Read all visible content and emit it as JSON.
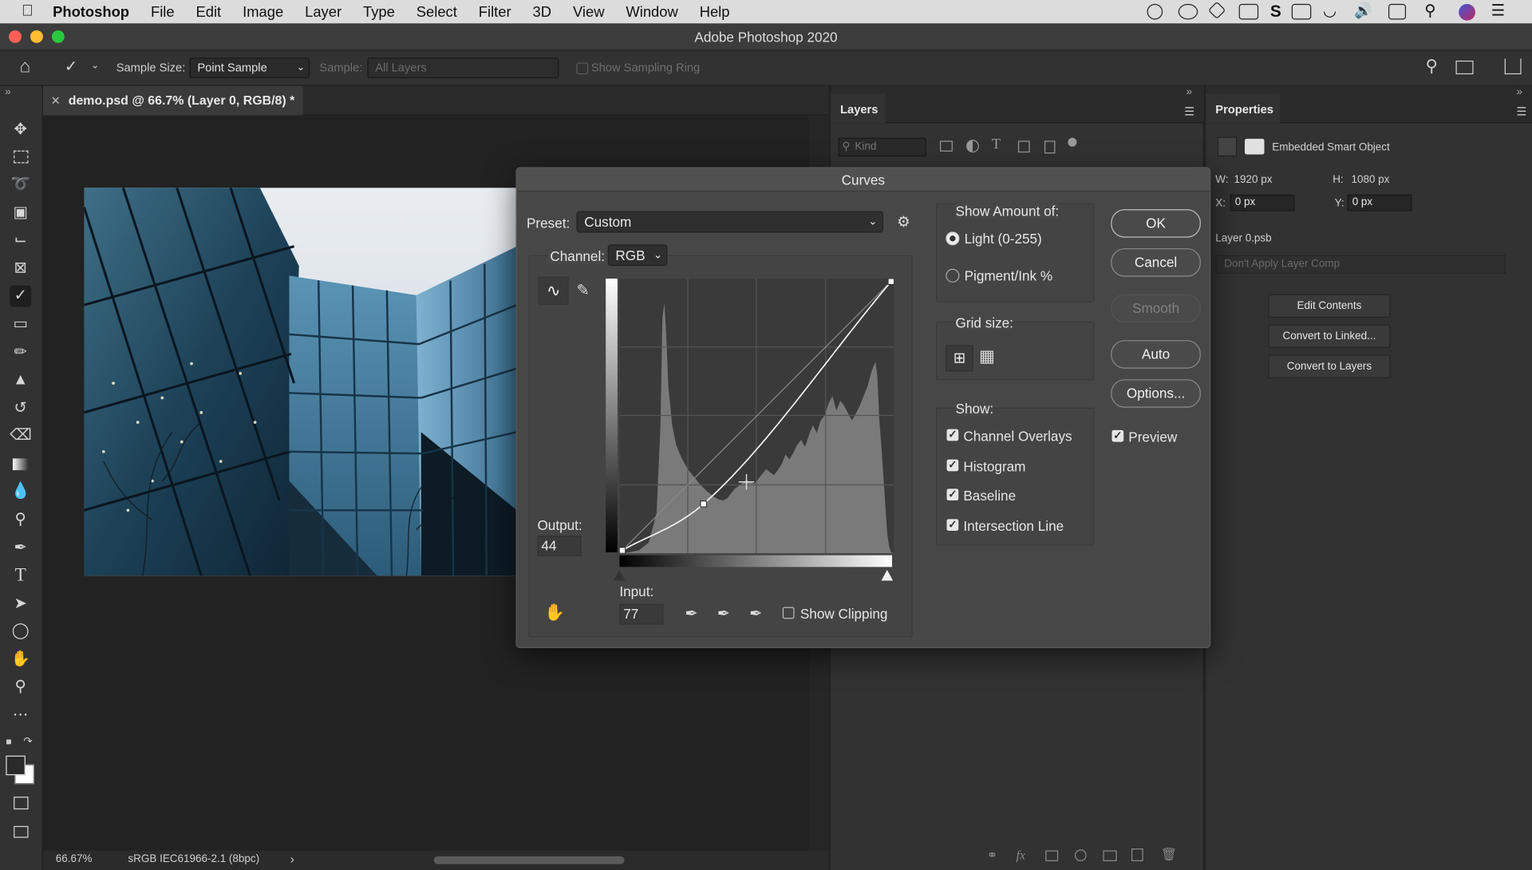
{
  "menubar": {
    "app_name": "Photoshop",
    "items": [
      "File",
      "Edit",
      "Image",
      "Layer",
      "Type",
      "Select",
      "Filter",
      "3D",
      "View",
      "Window",
      "Help"
    ]
  },
  "window": {
    "title": "Adobe Photoshop 2020"
  },
  "options_bar": {
    "sample_size_label": "Sample Size:",
    "sample_size_value": "Point Sample",
    "sample_label": "Sample:",
    "sample_value": "All Layers",
    "show_sampling_ring_label": "Show Sampling Ring"
  },
  "document": {
    "tab_title": "demo.psd @ 66.7% (Layer 0, RGB/8) *",
    "zoom": "66.67%",
    "color_profile": "sRGB IEC61966-2.1 (8bpc)"
  },
  "layers_panel": {
    "title": "Layers",
    "filter_placeholder": "Kind"
  },
  "properties_panel": {
    "title": "Properties",
    "object_type": "Embedded Smart Object",
    "w_label": "W:",
    "w_value": "1920 px",
    "h_label": "H:",
    "h_value": "1080 px",
    "x_label": "X:",
    "x_value": "0 px",
    "y_label": "Y:",
    "y_value": "0 px",
    "source_file": "Layer 0.psb",
    "layer_comp": "Don't Apply Layer Comp",
    "buttons": [
      "Edit Contents",
      "Convert to Linked...",
      "Convert to Layers"
    ]
  },
  "curves_dialog": {
    "title": "Curves",
    "preset_label": "Preset:",
    "preset_value": "Custom",
    "channel_label": "Channel:",
    "channel_value": "RGB",
    "output_label": "Output:",
    "output_value": "44",
    "input_label": "Input:",
    "input_value": "77",
    "show_clipping_label": "Show Clipping",
    "show_clipping_checked": false,
    "show_amount_label": "Show Amount of:",
    "light_label": "Light  (0-255)",
    "pigment_label": "Pigment/Ink %",
    "show_amount_selected": "light",
    "grid_size_label": "Grid size:",
    "show_label": "Show:",
    "show_options": [
      {
        "label": "Channel Overlays",
        "checked": true
      },
      {
        "label": "Histogram",
        "checked": true
      },
      {
        "label": "Baseline",
        "checked": true
      },
      {
        "label": "Intersection Line",
        "checked": true
      }
    ],
    "buttons": {
      "ok": "OK",
      "cancel": "Cancel",
      "smooth": "Smooth",
      "auto": "Auto",
      "options": "Options..."
    },
    "preview_label": "Preview",
    "preview_checked": true,
    "curve_points": [
      [
        0,
        0
      ],
      [
        77,
        44
      ],
      [
        255,
        255
      ]
    ]
  }
}
